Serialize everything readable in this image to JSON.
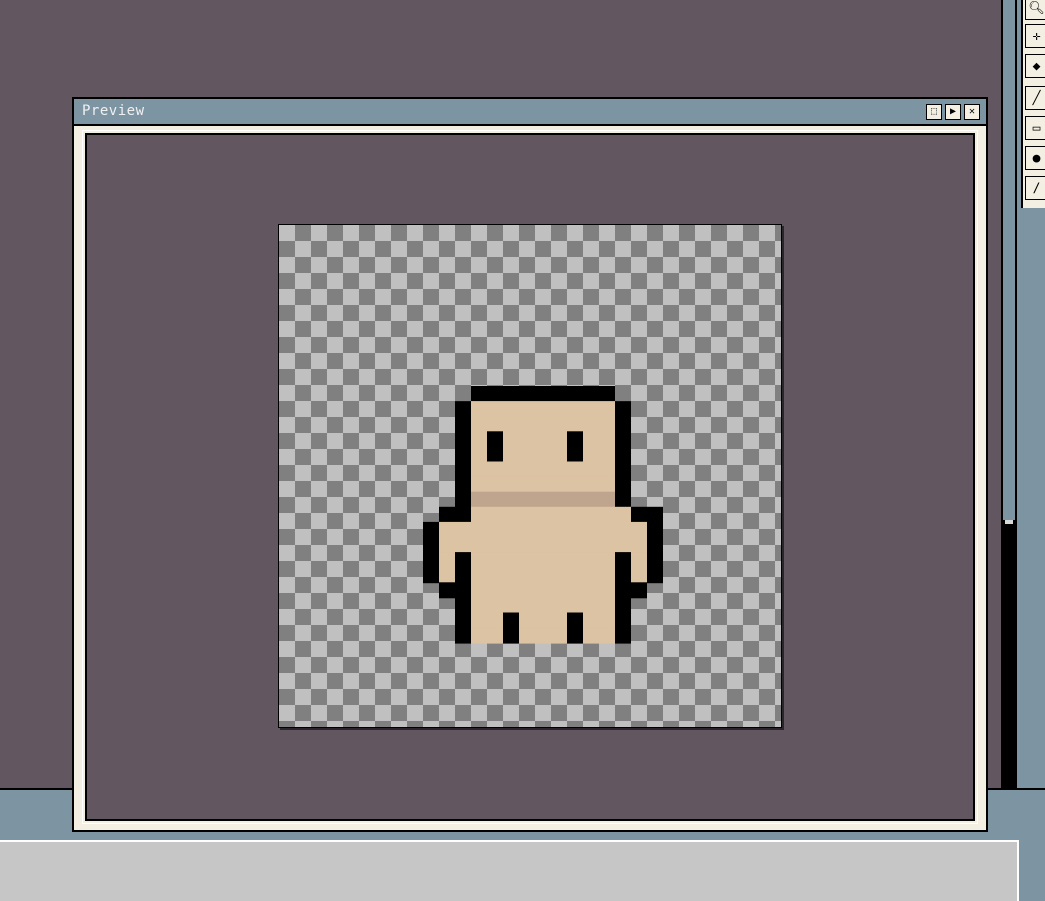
{
  "window": {
    "title": "Preview",
    "buttons": [
      "center-icon",
      "play-icon",
      "close-icon"
    ]
  },
  "toolbar": {
    "tools": [
      "zoom-icon",
      "move-icon",
      "fill-icon",
      "line-icon",
      "rectangle-icon",
      "blob-icon",
      "brush-icon"
    ]
  },
  "sprite": {
    "colors": {
      "outline": "#000000",
      "skin": "#dcc3a3",
      "shadow": "#bfa58d"
    }
  },
  "colors": {
    "workspace": "#625660",
    "titlebar": "#7d95a3",
    "panel": "#f3efe3",
    "checker_light": "#c0c0c0",
    "checker_dark": "#808080"
  }
}
